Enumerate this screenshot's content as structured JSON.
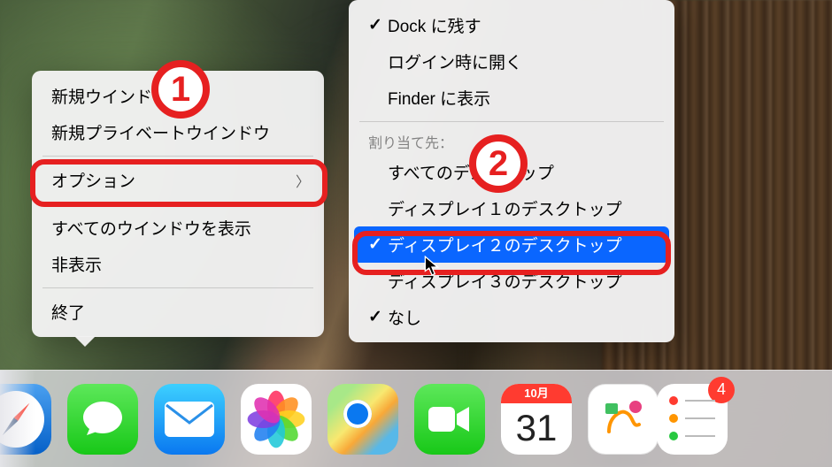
{
  "annotations": {
    "badge1": "1",
    "badge2": "2"
  },
  "main_menu": {
    "items": [
      {
        "label": "新規ウインドウ"
      },
      {
        "label": "新規プライベートウインドウ"
      },
      {
        "label": "オプション",
        "submenu": true
      },
      {
        "label": "すべてのウインドウを表示"
      },
      {
        "label": "非表示"
      },
      {
        "label": "終了"
      }
    ]
  },
  "options_submenu": {
    "top": [
      {
        "label": "Dock に残す",
        "checked": true
      },
      {
        "label": "ログイン時に開く",
        "checked": false
      },
      {
        "label": "Finder に表示",
        "checked": false
      }
    ],
    "section_label": "割り当て先：",
    "assign": [
      {
        "label": "すべてのデスクトップ",
        "checked": false
      },
      {
        "label": "ディスプレイ１のデスクトップ",
        "checked": false
      },
      {
        "label": "ディスプレイ２のデスクトップ",
        "checked": true,
        "selected": true
      },
      {
        "label": "ディスプレイ３のデスクトップ",
        "checked": false
      },
      {
        "label": "なし",
        "checked": true
      }
    ]
  },
  "dock": {
    "calendar": {
      "month": "10月",
      "day": "31"
    },
    "reminders_badge": "4"
  }
}
